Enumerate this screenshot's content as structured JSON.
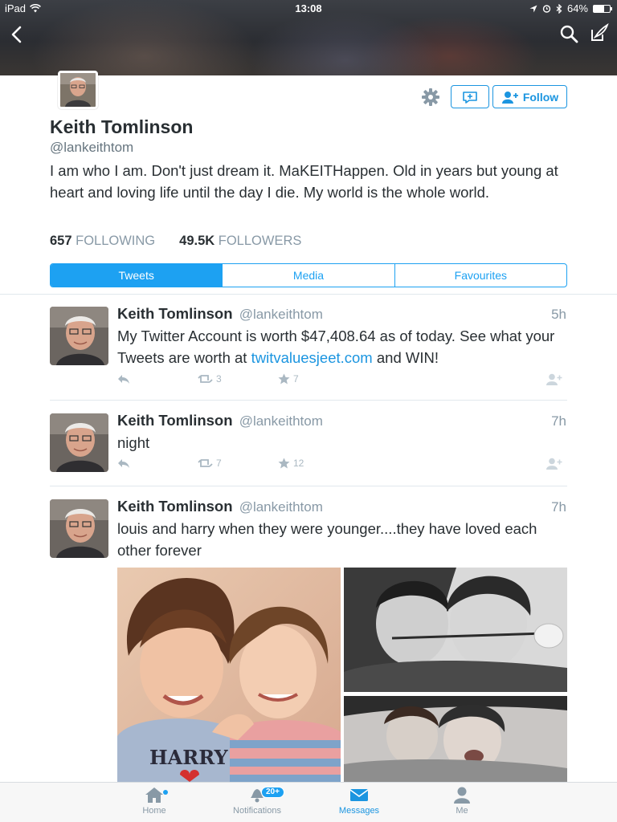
{
  "status_bar": {
    "device": "iPad",
    "time": "13:08",
    "battery": "64%",
    "battery_level": 0.64
  },
  "header": {
    "icons": [
      "back-icon",
      "search-icon",
      "compose-icon"
    ]
  },
  "profile": {
    "name": "Keith Tomlinson",
    "handle": "@lankeithtom",
    "bio": "I am who I am. Don't just dream it. MaKEITHappen. Old in years but young at heart and loving life until the day I die. My world is the whole world.",
    "following_count": "657",
    "following_label": "FOLLOWING",
    "followers_count": "49.5K",
    "followers_label": "FOLLOWERS",
    "follow_label": "Follow"
  },
  "tabs": [
    {
      "label": "Tweets",
      "active": true
    },
    {
      "label": "Media",
      "active": false
    },
    {
      "label": "Favourites",
      "active": false
    }
  ],
  "tweets": [
    {
      "name": "Keith Tomlinson",
      "handle": "@lankeithtom",
      "time": "5h",
      "text_before": "My Twitter Account is worth $47,408.64 as of today. See what your Tweets are worth at ",
      "link": "twitvaluesjeet.com",
      "text_after": " and WIN!",
      "retweets": "3",
      "favorites": "7"
    },
    {
      "name": "Keith Tomlinson",
      "handle": "@lankeithtom",
      "time": "7h",
      "text": "night",
      "retweets": "7",
      "favorites": "12"
    },
    {
      "name": "Keith Tomlinson",
      "handle": "@lankeithtom",
      "time": "7h",
      "text": "louis and harry when they were younger....they have loved each other forever",
      "media_shirt_text": "HARRY"
    }
  ],
  "tabbar": {
    "items": [
      {
        "label": "Home",
        "icon": "home-icon"
      },
      {
        "label": "Notifications",
        "icon": "bell-icon",
        "badge": "20+"
      },
      {
        "label": "Messages",
        "icon": "envelope-icon",
        "active": true
      },
      {
        "label": "Me",
        "icon": "person-icon"
      }
    ]
  },
  "colors": {
    "accent": "#1da1f2",
    "link": "#1b95e0",
    "text": "#292f33",
    "muted": "#8899a6"
  }
}
